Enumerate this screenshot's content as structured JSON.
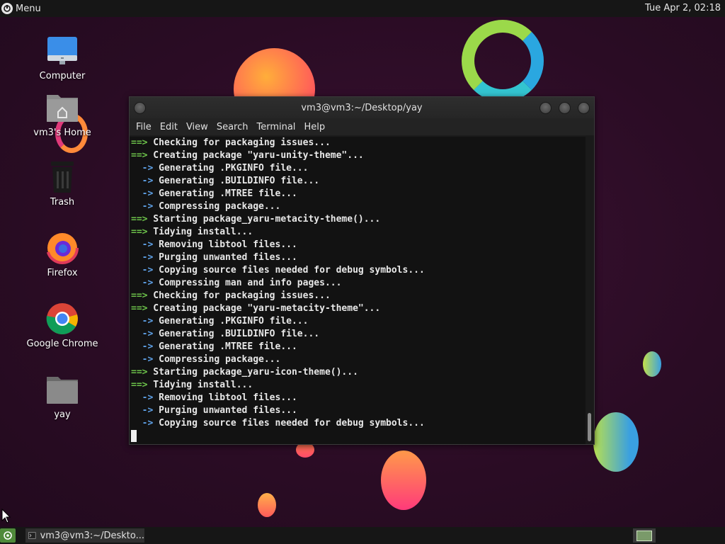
{
  "top_panel": {
    "menu_label": "Menu",
    "clock": "Tue Apr  2, 02:18"
  },
  "desktop_icons": [
    {
      "label": "Computer",
      "icon": "computer-icon"
    },
    {
      "label": "vm3's Home",
      "icon": "home-folder-icon"
    },
    {
      "label": "Trash",
      "icon": "trash-icon"
    },
    {
      "label": "Firefox",
      "icon": "firefox-icon"
    },
    {
      "label": "Google Chrome",
      "icon": "chrome-icon"
    },
    {
      "label": "yay",
      "icon": "folder-icon"
    }
  ],
  "terminal": {
    "title": "vm3@vm3:~/Desktop/yay",
    "menu": [
      "File",
      "Edit",
      "View",
      "Search",
      "Terminal",
      "Help"
    ],
    "lines": [
      {
        "prefix": "==>",
        "text": " Checking for packaging issues..."
      },
      {
        "prefix": "==>",
        "text": " Creating package \"yaru-unity-theme\"..."
      },
      {
        "prefix": "  ->",
        "text": " Generating .PKGINFO file..."
      },
      {
        "prefix": "  ->",
        "text": " Generating .BUILDINFO file..."
      },
      {
        "prefix": "  ->",
        "text": " Generating .MTREE file..."
      },
      {
        "prefix": "  ->",
        "text": " Compressing package..."
      },
      {
        "prefix": "==>",
        "text": " Starting package_yaru-metacity-theme()..."
      },
      {
        "prefix": "==>",
        "text": " Tidying install..."
      },
      {
        "prefix": "  ->",
        "text": " Removing libtool files..."
      },
      {
        "prefix": "  ->",
        "text": " Purging unwanted files..."
      },
      {
        "prefix": "  ->",
        "text": " Copying source files needed for debug symbols..."
      },
      {
        "prefix": "  ->",
        "text": " Compressing man and info pages..."
      },
      {
        "prefix": "==>",
        "text": " Checking for packaging issues..."
      },
      {
        "prefix": "==>",
        "text": " Creating package \"yaru-metacity-theme\"..."
      },
      {
        "prefix": "  ->",
        "text": " Generating .PKGINFO file..."
      },
      {
        "prefix": "  ->",
        "text": " Generating .BUILDINFO file..."
      },
      {
        "prefix": "  ->",
        "text": " Generating .MTREE file..."
      },
      {
        "prefix": "  ->",
        "text": " Compressing package..."
      },
      {
        "prefix": "==>",
        "text": " Starting package_yaru-icon-theme()..."
      },
      {
        "prefix": "==>",
        "text": " Tidying install..."
      },
      {
        "prefix": "  ->",
        "text": " Removing libtool files..."
      },
      {
        "prefix": "  ->",
        "text": " Purging unwanted files..."
      },
      {
        "prefix": "  ->",
        "text": " Copying source files needed for debug symbols..."
      }
    ]
  },
  "taskbar": {
    "window_label": "vm3@vm3:~/Deskto..."
  },
  "colors": {
    "prompt_green": "#6cc24a",
    "arrow_blue": "#5ea0e6",
    "terminal_bg": "#121212"
  }
}
